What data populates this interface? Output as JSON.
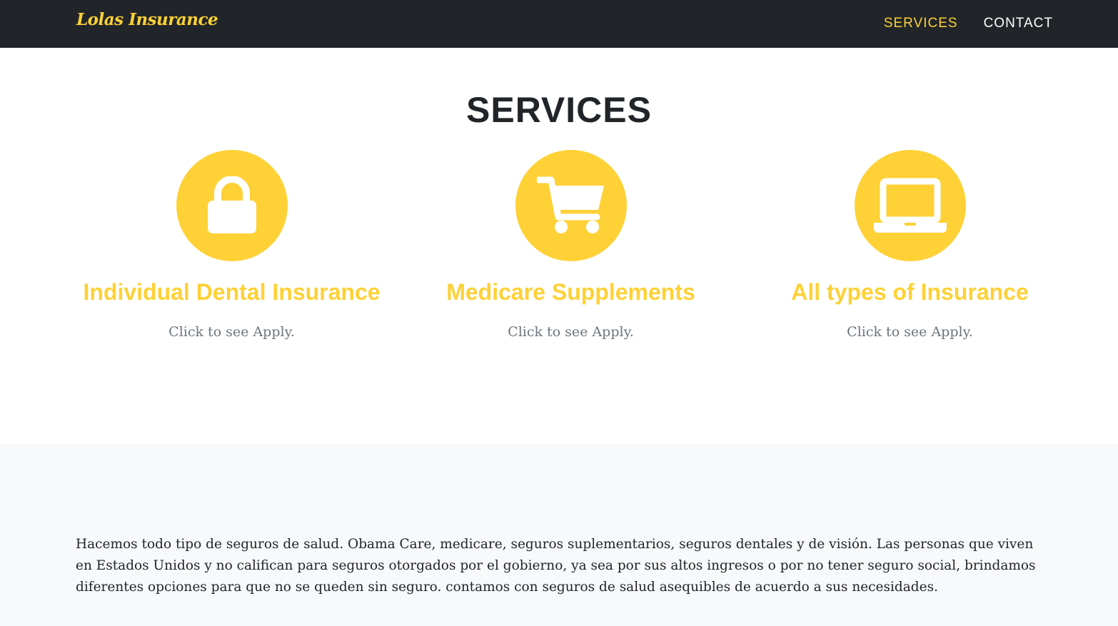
{
  "navbar": {
    "brand": "Lolas Insurance",
    "links": [
      {
        "label": "SERVICES",
        "active": true
      },
      {
        "label": "CONTACT",
        "active": false
      }
    ]
  },
  "services": {
    "heading": "SERVICES",
    "items": [
      {
        "icon": "lock-icon",
        "title": "Individual Dental Insurance",
        "text": "Click to see Apply."
      },
      {
        "icon": "shopping-cart-icon",
        "title": "Medicare Supplements",
        "text": "Click to see Apply."
      },
      {
        "icon": "laptop-icon",
        "title": "All types of Insurance",
        "text": "Click to see Apply."
      }
    ]
  },
  "about": {
    "text": "Hacemos todo tipo de seguros de salud. Obama Care, medicare, seguros suplementarios, seguros dentales y de visión. Las personas que viven en Estados Unidos y no califican para seguros otorgados por el gobierno, ya sea por sus altos ingresos o por no tener seguro social, brindamos diferentes opciones para que no se queden sin seguro. contamos con seguros de salud asequibles de acuerdo a sus necesidades."
  },
  "colors": {
    "accent": "#fed136",
    "navbar_bg": "#212529",
    "heading": "#212529",
    "muted_text": "#6c757d",
    "about_bg": "#f8f9fa"
  }
}
